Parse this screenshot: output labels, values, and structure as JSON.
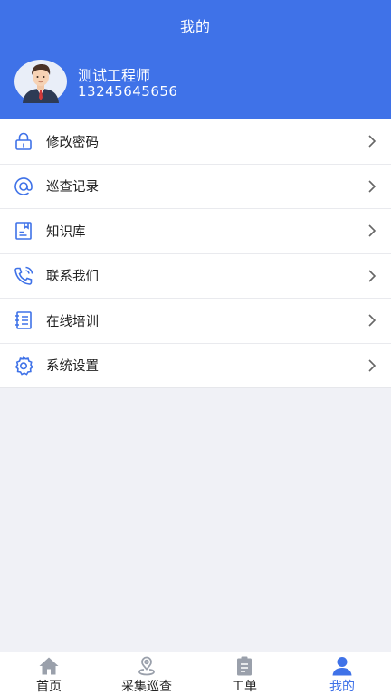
{
  "header": {
    "title": "我的",
    "user_name": "测试工程师",
    "user_phone": "13245645656"
  },
  "menu": {
    "items": [
      {
        "label": "修改密码",
        "icon": "lock-icon"
      },
      {
        "label": "巡查记录",
        "icon": "at-icon"
      },
      {
        "label": "知识库",
        "icon": "book-icon"
      },
      {
        "label": "联系我们",
        "icon": "phone-icon"
      },
      {
        "label": "在线培训",
        "icon": "notebook-icon"
      },
      {
        "label": "系统设置",
        "icon": "gear-icon"
      }
    ]
  },
  "tabbar": {
    "tabs": [
      {
        "label": "首页",
        "icon": "home-icon"
      },
      {
        "label": "采集巡查",
        "icon": "location-pin-icon"
      },
      {
        "label": "工单",
        "icon": "clipboard-icon"
      },
      {
        "label": "我的",
        "icon": "user-icon"
      }
    ],
    "active": "我的"
  },
  "colors": {
    "primary": "#3f72e8",
    "background": "#f0f1f6",
    "icon_blue": "#3f72e8",
    "tab_gray": "#9aa0ab"
  }
}
